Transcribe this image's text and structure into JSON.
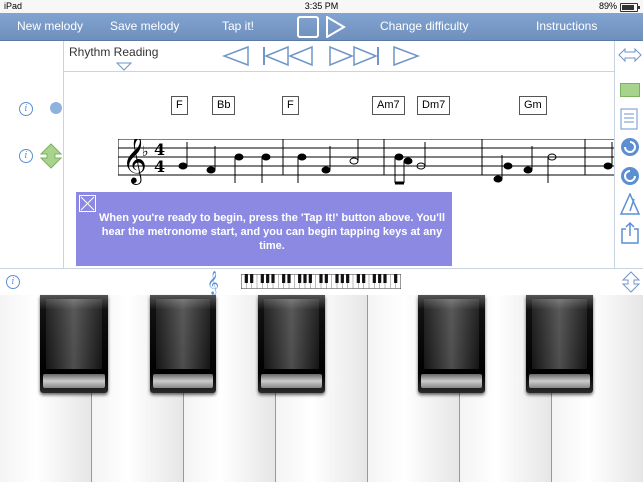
{
  "status": {
    "device": "iPad",
    "time": "3:35 PM",
    "battery": "89%"
  },
  "toolbar": {
    "new_melody": "New melody",
    "save_melody": "Save melody",
    "tap_it": "Tap it!",
    "change_difficulty": "Change difficulty",
    "instructions": "Instructions"
  },
  "score": {
    "title": "Rhythm Reading",
    "time_signature": "4/4",
    "key": "F",
    "chords": [
      "F",
      "Bb",
      "F",
      "Am7",
      "Dm7",
      "Gm"
    ]
  },
  "message": {
    "text": "When you're ready to begin, press the 'Tap It!' button above. You'll hear the metronome start, and you can begin tapping keys at any time."
  },
  "icons": {
    "info": "i",
    "colors": {
      "accent": "#5b8fd2",
      "message_bg": "#8c89e3",
      "toolbar": "#7b9bc9",
      "highlight": "#a8d38c"
    }
  }
}
